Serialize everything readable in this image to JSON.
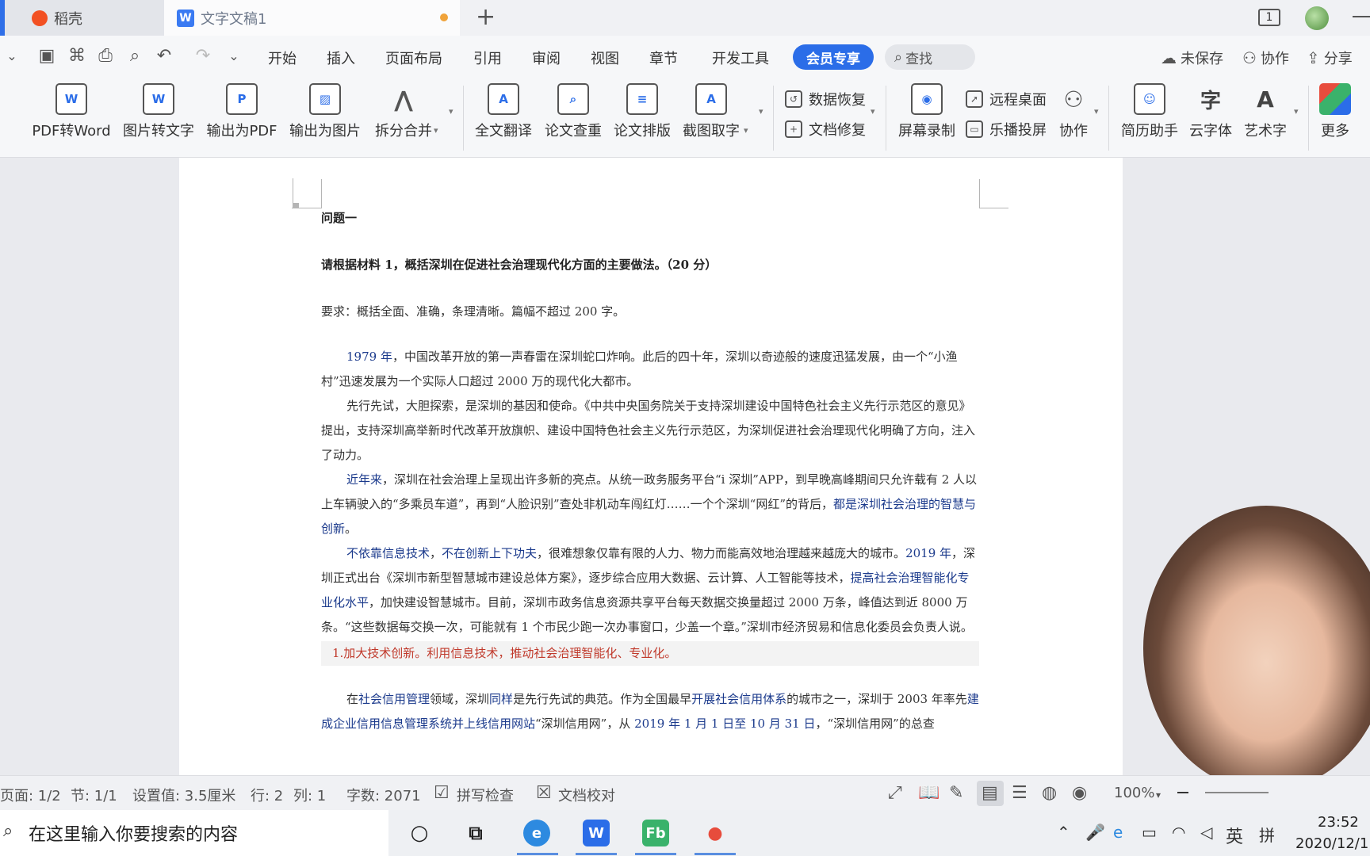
{
  "tabs": {
    "home_label": "稻壳",
    "doc_label": "文字文稿1",
    "new_tab": "+",
    "window_count": "1"
  },
  "menu": {
    "items": [
      "开始",
      "插入",
      "页面布局",
      "引用",
      "审阅",
      "视图",
      "章节",
      "开发工具"
    ],
    "member_button": "会员专享",
    "search_label": "查找",
    "unsaved": "未保存",
    "collaborate": "协作",
    "share": "分享"
  },
  "ribbon": {
    "pdf_to_word": "PDF转Word",
    "image_to_text": "图片转文字",
    "export_pdf": "输出为PDF",
    "export_image": "输出为图片",
    "split_merge": "拆分合并",
    "full_translate": "全文翻译",
    "paper_check": "论文查重",
    "paper_layout": "论文排版",
    "screenshot_text": "截图取字",
    "data_recovery": "数据恢复",
    "doc_repair": "文档修复",
    "screen_record": "屏幕录制",
    "remote_desktop": "远程桌面",
    "cast_screen": "乐播投屏",
    "collab": "协作",
    "resume_helper": "简历助手",
    "cloud_font": "云字体",
    "art_text": "艺术字",
    "more": "更多"
  },
  "document": {
    "heading": "问题一",
    "question": "请根据材料 1，概括深圳在促进社会治理现代化方面的主要做法。（20 分）",
    "requirement": "要求：概括全面、准确，条理清晰。篇幅不超过 200 字。",
    "p1_year": "1979 年",
    "p1_rest": "，中国改革开放的第一声春雷在深圳蛇口炸响。此后的四十年，深圳以奇迹般的速度迅猛发展，由一个“小渔村”迅速发展为一个实际人口超过 2000 万的现代化大都市。",
    "p2": "先行先试，大胆探索，是深圳的基因和使命。《中共中央国务院关于支持深圳建设中国特色社会主义先行示范区的意见》提出，支持深圳高举新时代改革开放旗帜、建设中国特色社会主义先行示范区，为深圳促进社会治理现代化明确了方向，注入了动力。",
    "p3_a": "近年来",
    "p3_b": "，深圳在社会治理上呈现出许多新的亮点。从统一政务服务平台“i 深圳”APP，到早晚高峰期间只允许载有 2 人以上车辆驶入的“多乘员车道”，再到“人脸识别”查处非机动车闯红灯……一个个深圳“网红”的背后，",
    "p3_c": "都是深圳社会治理的智慧与创新",
    "p3_d": "。",
    "p4_a": "不依靠信息技术",
    "p4_b": "，",
    "p4_c": "不在创新上下功夫",
    "p4_d": "，很难想象仅靠有限的人力、物力而能高效地治理越来越庞大的城市。",
    "p4_e": "2019 年",
    "p4_f": "，深圳正式出台《深圳市新型智慧城市建设总体方案》，逐步综合应用大数据、云计算、人工智能等技术，",
    "p4_g": "提高社会治理智能化专业化水平",
    "p4_h": "，加快建设智慧城市。目前，深圳市政务信息资源共享平台每天数据交换量超过 2000 万条，峰值达到近 8000 万条。“这些数据每交换一次，可能就有 1 个市民少跑一次办事窗口，少盖一个章。”深圳市经济贸易和信息化委员会负责人说。",
    "note": "1.加大技术创新。利用信息技术，推动社会治理智能化、专业化。",
    "p5_a": "在",
    "p5_b": "社会信用管理",
    "p5_c": "领域，深圳",
    "p5_d": "同样",
    "p5_e": "是先行先试的典范。作为全国最早",
    "p5_f": "开展社会信用体系",
    "p5_g": "的城市之一，深圳于 2003 年率先",
    "p5_h": "建成企业信用信息管理系统并上线信用网站",
    "p5_i": "“深圳信用网”，从 ",
    "p5_j": "2019 年 1 月 1 日至 10 月 31 日",
    "p5_k": "，“深圳信用网”的总查"
  },
  "status": {
    "page": "页面: 1/2",
    "section": "节: 1/1",
    "setting": "设置值: 3.5厘米",
    "row": "行: 2",
    "col": "列: 1",
    "word_count": "字数: 2071",
    "spell_check": "拼写检查",
    "proofread": "文档校对",
    "zoom": "100%"
  },
  "taskbar": {
    "search_placeholder": "在这里输入你要搜索的内容",
    "ime_lang": "英",
    "ime_mode": "拼",
    "time": "23:52",
    "date": "2020/12/1"
  },
  "colors": {
    "accent": "#2b6de8",
    "blue_text": "#1b3a8c",
    "note_red": "#c0392b"
  }
}
